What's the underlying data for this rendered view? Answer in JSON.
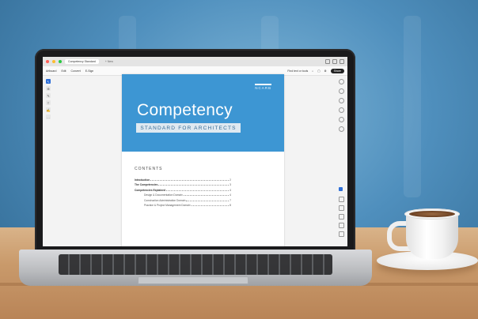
{
  "app": {
    "tab_active": "Competency Standard",
    "tab_new": "+ New",
    "menu": [
      "Artboard",
      "Edit",
      "Convert",
      "E-Sign"
    ],
    "find_label": "Find text or tools",
    "share_label": "Share"
  },
  "document": {
    "brand": "NCARB",
    "title": "Competency",
    "subtitle": "STANDARD FOR ARCHITECTS",
    "contents_heading": "CONTENTS",
    "toc": [
      {
        "label": "Introduction",
        "page": "2",
        "level": 1
      },
      {
        "label": "The Competencies",
        "page": "3",
        "level": 1
      },
      {
        "label": "Competencies Explained",
        "page": "4",
        "level": 1
      },
      {
        "label": "Design & Documentation Domain",
        "page": "4",
        "level": 2
      },
      {
        "label": "Construction Administration Domain",
        "page": "7",
        "level": 2
      },
      {
        "label": "Practice & Project Management Domain",
        "page": "8",
        "level": 2
      }
    ]
  },
  "colors": {
    "cover_blue": "#3d96d3",
    "accent_blue": "#2e6fd8"
  }
}
